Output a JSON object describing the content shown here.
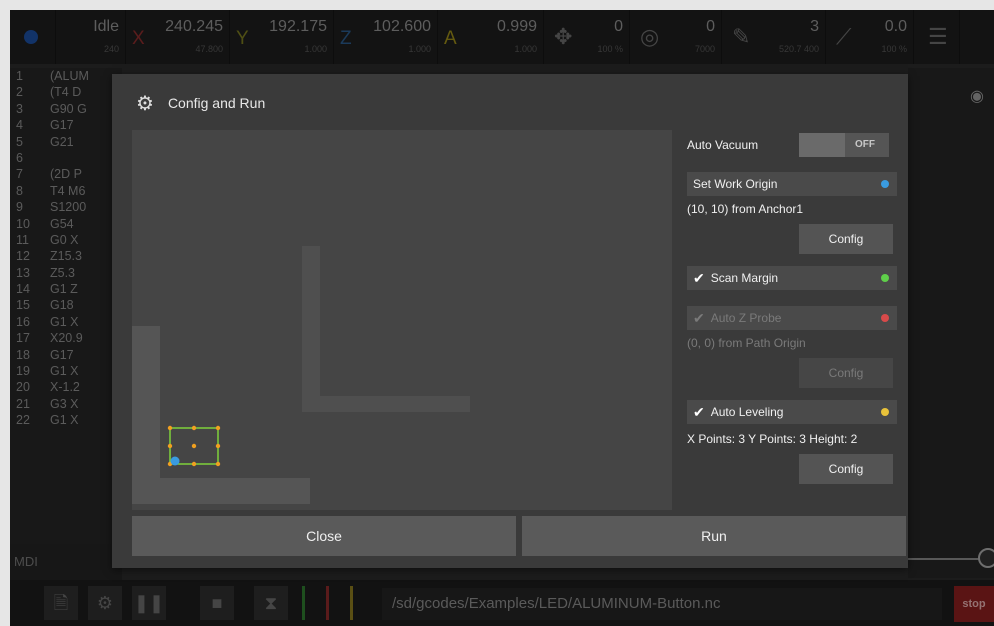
{
  "topbar": {
    "state": "Idle",
    "state_sub": "240",
    "x_label": "X",
    "x_value": "240.245",
    "x_sub": "47.800",
    "y_label": "Y",
    "y_value": "192.175",
    "y_sub": "1.000",
    "z_label": "Z",
    "z_value": "102.600",
    "z_sub": "1.000",
    "a_label": "A",
    "a_value": "0.999",
    "a_sub": "1.000",
    "feed_value": "0",
    "feed_sub": "100 %",
    "spindle_value": "0",
    "spindle_sub": "7000",
    "tool_value": "3",
    "tool_sub": "520.7 400",
    "laser_value": "0.0",
    "laser_sub": "100 %"
  },
  "gcode": [
    {
      "n": "1",
      "t": "(ALUM"
    },
    {
      "n": "2",
      "t": "(T4  D"
    },
    {
      "n": "3",
      "t": "G90 G"
    },
    {
      "n": "4",
      "t": "G17"
    },
    {
      "n": "5",
      "t": "G21"
    },
    {
      "n": "6",
      "t": ""
    },
    {
      "n": "7",
      "t": "(2D P"
    },
    {
      "n": "8",
      "t": "T4 M6"
    },
    {
      "n": "9",
      "t": "S1200"
    },
    {
      "n": "10",
      "t": " G54"
    },
    {
      "n": "11",
      "t": " G0 X"
    },
    {
      "n": "12",
      "t": " Z15.3"
    },
    {
      "n": "13",
      "t": " Z5.3"
    },
    {
      "n": "14",
      "t": " G1 Z"
    },
    {
      "n": "15",
      "t": " G18 "
    },
    {
      "n": "16",
      "t": " G1 X"
    },
    {
      "n": "17",
      "t": " X20.9"
    },
    {
      "n": "18",
      "t": " G17 "
    },
    {
      "n": "19",
      "t": " G1 X"
    },
    {
      "n": "20",
      "t": " X-1.2"
    },
    {
      "n": "21",
      "t": " G3 X"
    },
    {
      "n": "22",
      "t": " G1 X"
    }
  ],
  "mdi_label": "MDI",
  "bottombar": {
    "file_path": "/sd/gcodes/Examples/LED/ALUMINUM-Button.nc",
    "stop_label": "stop"
  },
  "dialog": {
    "title": "Config and Run",
    "auto_vacuum_label": "Auto Vacuum",
    "auto_vacuum_state": "OFF",
    "set_work_origin_label": "Set Work Origin",
    "set_work_origin_info": "(10, 10) from Anchor1",
    "config_label": "Config",
    "scan_margin_label": "Scan Margin",
    "auto_z_probe_label": "Auto Z Probe",
    "auto_z_probe_info": "(0, 0) from Path Origin",
    "auto_leveling_label": "Auto Leveling",
    "auto_leveling_info": "X Points: 3 Y Points: 3 Height: 2",
    "close_label": "Close",
    "run_label": "Run"
  },
  "colors": {
    "origin_dot": "#3a9be0",
    "scan_dot": "#5fcf4a",
    "probe_dot": "#d84a4a",
    "leveling_dot": "#e8c23a",
    "path_rect": "#7fd13b",
    "grid_point": "#f0a020"
  }
}
